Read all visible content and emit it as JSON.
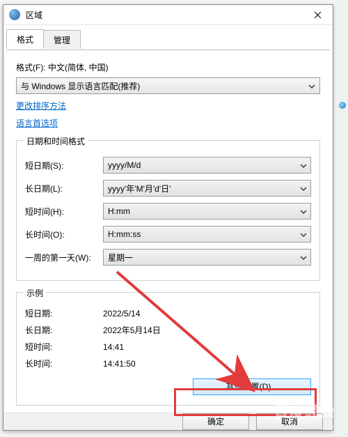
{
  "window": {
    "title": "区域"
  },
  "tabs": {
    "format": "格式",
    "admin": "管理"
  },
  "format": {
    "label": "格式(F): 中文(简体, 中国)",
    "select_value": "与 Windows 显示语言匹配(推荐)"
  },
  "links": {
    "sort": "更改排序方法",
    "prefs": "语言首选项"
  },
  "dt_group": {
    "legend": "日期和时间格式",
    "rows": {
      "short_date": {
        "label": "短日期(S):",
        "value": "yyyy/M/d"
      },
      "long_date": {
        "label": "长日期(L):",
        "value": "yyyy'年'M'月'd'日'"
      },
      "short_time": {
        "label": "短时间(H):",
        "value": "H:mm"
      },
      "long_time": {
        "label": "长时间(O):",
        "value": "H:mm:ss"
      },
      "first_day": {
        "label": "一周的第一天(W):",
        "value": "星期一"
      }
    }
  },
  "ex_group": {
    "legend": "示例",
    "rows": {
      "short_date": {
        "label": "短日期:",
        "value": "2022/5/14"
      },
      "long_date": {
        "label": "长日期:",
        "value": "2022年5月14日"
      },
      "short_time": {
        "label": "短时间:",
        "value": "14:41"
      },
      "long_time": {
        "label": "长时间:",
        "value": "14:41:50"
      }
    }
  },
  "buttons": {
    "more": "其他设置(D)...",
    "ok": "确定",
    "cancel": "取消"
  },
  "watermark": {
    "brand": "百度经验",
    "url": "jingyan.baidu.com"
  }
}
